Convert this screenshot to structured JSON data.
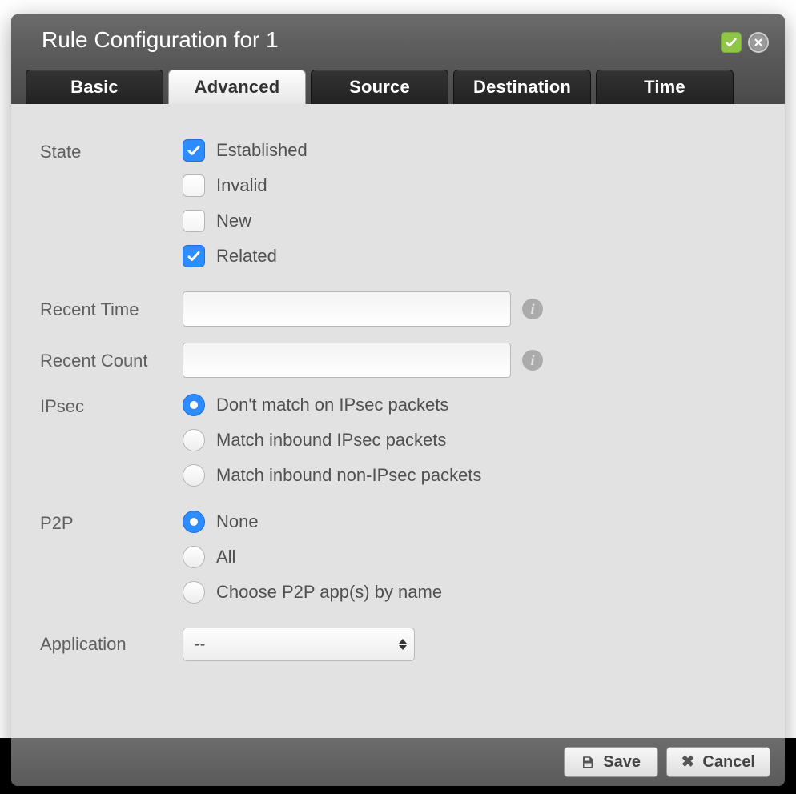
{
  "title": "Rule Configuration for 1",
  "tabs": {
    "basic": {
      "label": "Basic"
    },
    "advanced": {
      "label": "Advanced"
    },
    "source": {
      "label": "Source"
    },
    "destination": {
      "label": "Destination"
    },
    "time": {
      "label": "Time"
    }
  },
  "labels": {
    "state": "State",
    "recentTime": "Recent Time",
    "recentCount": "Recent Count",
    "ipsec": "IPsec",
    "p2p": "P2P",
    "application": "Application"
  },
  "state": {
    "established": {
      "label": "Established",
      "checked": true
    },
    "invalid": {
      "label": "Invalid",
      "checked": false
    },
    "new": {
      "label": "New",
      "checked": false
    },
    "related": {
      "label": "Related",
      "checked": true
    }
  },
  "recentTime": {
    "value": ""
  },
  "recentCount": {
    "value": ""
  },
  "ipsec": {
    "opt1": {
      "label": "Don't match on IPsec packets",
      "selected": true
    },
    "opt2": {
      "label": "Match inbound IPsec packets",
      "selected": false
    },
    "opt3": {
      "label": "Match inbound non-IPsec packets",
      "selected": false
    }
  },
  "p2p": {
    "opt1": {
      "label": "None",
      "selected": true
    },
    "opt2": {
      "label": "All",
      "selected": false
    },
    "opt3": {
      "label": "Choose P2P app(s) by name",
      "selected": false
    }
  },
  "application": {
    "selected": "--"
  },
  "footer": {
    "save": "Save",
    "cancel": "Cancel"
  }
}
